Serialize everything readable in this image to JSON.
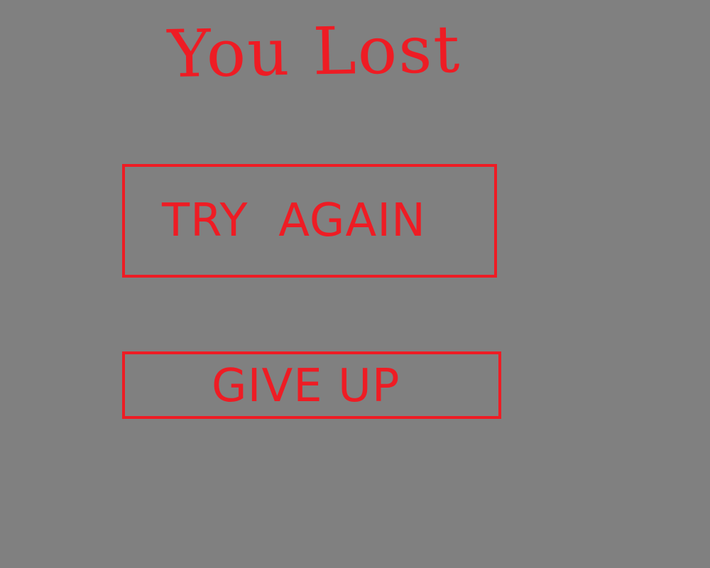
{
  "colors": {
    "background": "#808080",
    "accent": "#ee1c24"
  },
  "screen": {
    "title": "You Lost"
  },
  "buttons": {
    "try_again": "TRY  AGAIN",
    "give_up": "GIVE UP"
  }
}
